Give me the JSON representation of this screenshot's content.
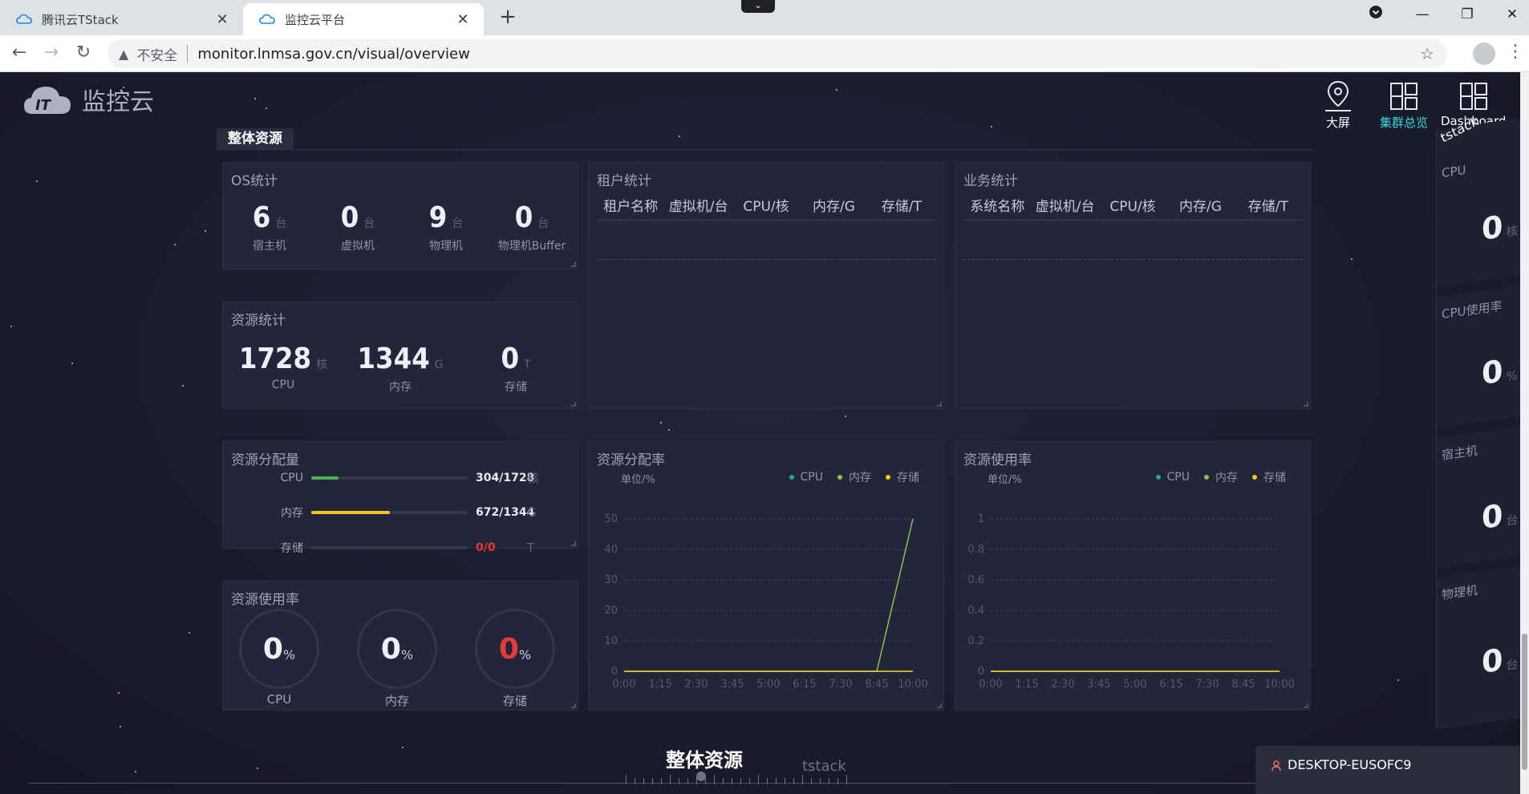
{
  "browser": {
    "tabs": [
      {
        "title": "腾讯云TStack",
        "active": false
      },
      {
        "title": "监控云平台",
        "active": true
      }
    ],
    "new_tab": "+",
    "address": {
      "security": "不安全",
      "url": "monitor.lnmsa.gov.cn/visual/overview"
    },
    "window_controls": {
      "minimize": "—",
      "restore": "❐",
      "close": "✕"
    }
  },
  "app": {
    "logo_text": "监控云",
    "logo_badge": "IT",
    "nav": [
      {
        "label": "大屏",
        "icon": "map-pin-icon",
        "active": false
      },
      {
        "label": "集群总览",
        "icon": "grid-icon",
        "active": true
      },
      {
        "label": "Dashboard",
        "icon": "dashboard-icon",
        "active": false
      }
    ],
    "section_title": "整体资源",
    "os_stats": {
      "title": "OS统计",
      "items": [
        {
          "value": "6",
          "unit": "台",
          "label": "宿主机"
        },
        {
          "value": "0",
          "unit": "台",
          "label": "虚拟机"
        },
        {
          "value": "9",
          "unit": "台",
          "label": "物理机"
        },
        {
          "value": "0",
          "unit": "台",
          "label": "物理机Buffer"
        }
      ]
    },
    "resource_stats": {
      "title": "资源统计",
      "items": [
        {
          "value": "1728",
          "unit": "核",
          "label": "CPU"
        },
        {
          "value": "1344",
          "unit": "G",
          "label": "内存"
        },
        {
          "value": "0",
          "unit": "T",
          "label": "存储"
        }
      ]
    },
    "tenant_stats": {
      "title": "租户统计",
      "columns": [
        "租户名称",
        "虚拟机/台",
        "CPU/核",
        "内存/G",
        "存储/T"
      ]
    },
    "business_stats": {
      "title": "业务统计",
      "columns": [
        "系统名称",
        "虚拟机/台",
        "CPU/核",
        "内存/G",
        "存储/T"
      ]
    },
    "allocation": {
      "title": "资源分配量",
      "rows": [
        {
          "label": "CPU",
          "value": "304/1728",
          "unit": "核",
          "ratio": 0.176,
          "color": "#4caf50"
        },
        {
          "label": "内存",
          "value": "672/1344",
          "unit": "G",
          "ratio": 0.5,
          "color": "#f5c518"
        },
        {
          "label": "存储",
          "value": "0/0",
          "unit": "T",
          "ratio": 0,
          "color": "#e53935"
        }
      ]
    },
    "usage_gauges": {
      "title": "资源使用率",
      "items": [
        {
          "value": "0",
          "pct": "%",
          "label": "CPU",
          "color": "#eef0f6"
        },
        {
          "value": "0",
          "pct": "%",
          "label": "内存",
          "color": "#eef0f6"
        },
        {
          "value": "0",
          "pct": "%",
          "label": "存储",
          "color": "#e53935"
        }
      ]
    },
    "alloc_rate": {
      "title": "资源分配率",
      "unit_label": "单位/%",
      "legend": [
        {
          "name": "CPU",
          "color": "#26a69a"
        },
        {
          "name": "内存",
          "color": "#8bc34a"
        },
        {
          "name": "存储",
          "color": "#f5c518"
        }
      ]
    },
    "usage_rate": {
      "title": "资源使用率",
      "unit_label": "单位/%",
      "legend": [
        {
          "name": "CPU",
          "color": "#26a69a"
        },
        {
          "name": "内存",
          "color": "#8bc34a"
        },
        {
          "name": "存储",
          "color": "#f5c518"
        }
      ]
    },
    "side_panel": {
      "tag": "tstack",
      "blocks": [
        {
          "title": "CPU",
          "value": "0",
          "unit": "核"
        },
        {
          "title": "CPU使用率",
          "value": "0",
          "unit": "%"
        },
        {
          "title": "宿主机",
          "value": "0",
          "unit": "台"
        },
        {
          "title": "物理机",
          "value": "0",
          "unit": "台"
        }
      ]
    },
    "bottom": {
      "title": "整体资源",
      "subtitle": "tstack"
    },
    "toast": {
      "device": "DESKTOP-EUSOFC9"
    }
  },
  "chart_data": [
    {
      "type": "line",
      "title": "资源分配率",
      "ylabel": "单位/%",
      "x": [
        "0:00",
        "1:15",
        "2:30",
        "3:45",
        "5:00",
        "6:15",
        "7:30",
        "8:45",
        "10:00"
      ],
      "yticks": [
        0,
        10,
        20,
        30,
        40,
        50
      ],
      "ylim": [
        0,
        50
      ],
      "series": [
        {
          "name": "CPU",
          "values": [
            0,
            0,
            0,
            0,
            0,
            0,
            0,
            0,
            0
          ]
        },
        {
          "name": "内存",
          "values": [
            0,
            0,
            0,
            0,
            0,
            0,
            0,
            0,
            50
          ]
        },
        {
          "name": "存储",
          "values": [
            0,
            0,
            0,
            0,
            0,
            0,
            0,
            0,
            0
          ]
        }
      ],
      "legend": "top-right",
      "grid": true
    },
    {
      "type": "line",
      "title": "资源使用率",
      "ylabel": "单位/%",
      "x": [
        "0:00",
        "1:15",
        "2:30",
        "3:45",
        "5:00",
        "6:15",
        "7:30",
        "8:45",
        "10:00"
      ],
      "yticks": [
        "0",
        "0.2",
        "0.4",
        "0.6",
        "0.8",
        "1"
      ],
      "ylim": [
        0,
        1
      ],
      "series": [
        {
          "name": "CPU",
          "values": [
            0,
            0,
            0,
            0,
            0,
            0,
            0,
            0,
            0
          ]
        },
        {
          "name": "内存",
          "values": [
            0,
            0,
            0,
            0,
            0,
            0,
            0,
            0,
            0
          ]
        },
        {
          "name": "存储",
          "values": [
            0,
            0,
            0,
            0,
            0,
            0,
            0,
            0,
            0
          ]
        }
      ],
      "legend": "top-right",
      "grid": true
    }
  ]
}
